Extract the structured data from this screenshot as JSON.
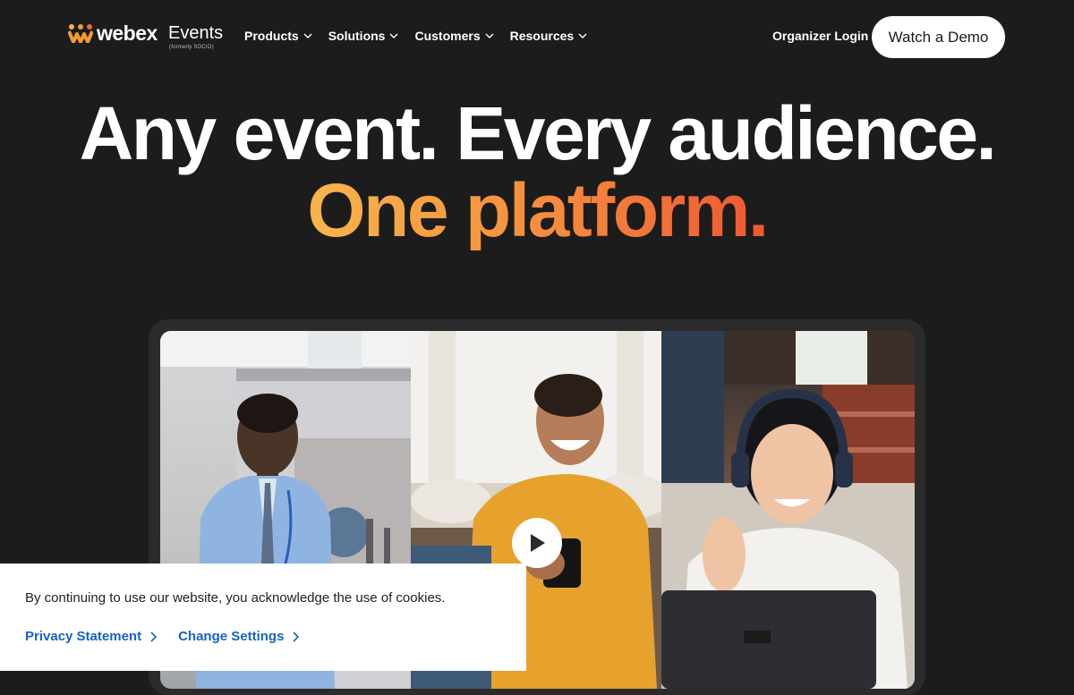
{
  "nav": {
    "logo": {
      "brand": "webex",
      "product": "Events",
      "formerly": "(formerly SOCIO)"
    },
    "menu": [
      {
        "label": "Products",
        "icon": "chevron-down-icon"
      },
      {
        "label": "Solutions",
        "icon": "chevron-down-icon"
      },
      {
        "label": "Customers",
        "icon": "chevron-down-icon"
      },
      {
        "label": "Resources",
        "icon": "chevron-down-icon"
      }
    ],
    "login_label": "Organizer Login",
    "demo_label": "Watch a Demo"
  },
  "hero": {
    "headline_line1": "Any event. Every audience.",
    "headline_line2": "One platform."
  },
  "video": {
    "play_icon": "play-icon",
    "panels": [
      "presenter-panel",
      "smiling-woman-phone-panel",
      "waving-woman-headphones-panel"
    ]
  },
  "cookie_banner": {
    "message": "By continuing to use our website, you acknowledge the use of cookies.",
    "links": [
      {
        "label": "Privacy Statement",
        "icon": "chevron-right-icon"
      },
      {
        "label": "Change Settings",
        "icon": "chevron-right-icon"
      }
    ]
  },
  "colors": {
    "background": "#1c1c1c",
    "accent_gradient": [
      "#f7b24a",
      "#f58a3c",
      "#ef5a33"
    ],
    "link": "#1565c0",
    "logo_orange": "#f39a34"
  }
}
